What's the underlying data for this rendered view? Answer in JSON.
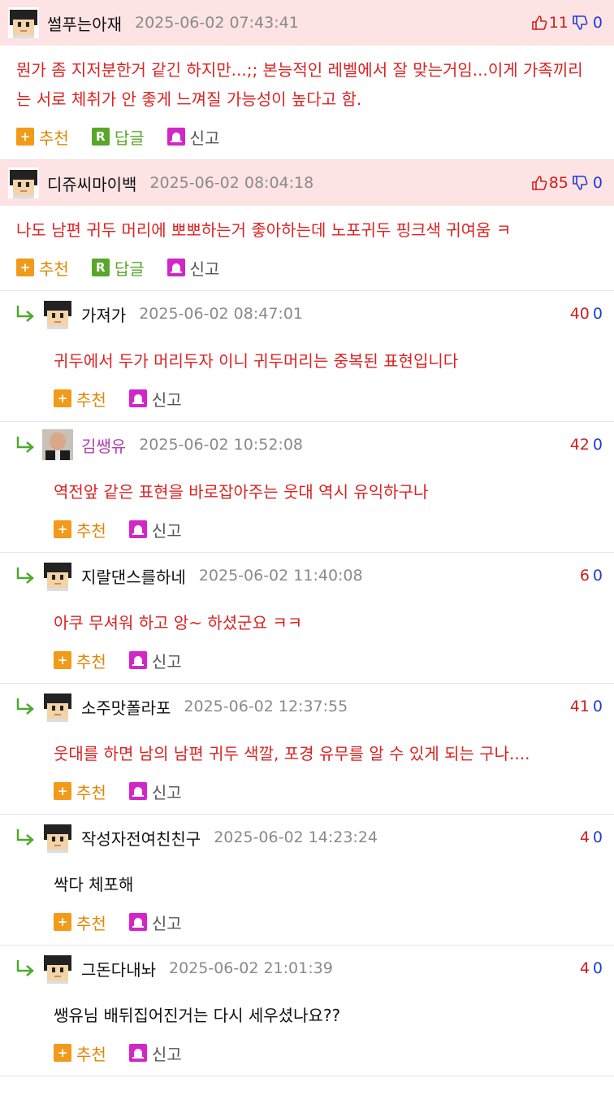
{
  "labels": {
    "recommend": "추천",
    "reply": "답글",
    "report": "신고"
  },
  "colors": {
    "accent_red": "#cc1f1f",
    "accent_blue": "#1f3fcc",
    "highlight_bg": "#fde3e3"
  },
  "comments": [
    {
      "nick": "썰푸는아재",
      "date": "2025-06-02 07:43:41",
      "up": "11",
      "down": "0",
      "text": "뭔가 좀 지저분한거 같긴 하지만...;; 본능적인 레벨에서 잘 맞는거임...이게 가족끼리는 서로 체취가 안 좋게 느껴질 가능성이 높다고 함."
    },
    {
      "nick": "디쥬씨마이백",
      "date": "2025-06-02 08:04:18",
      "up": "85",
      "down": "0",
      "text": "나도 남편 귀두 머리에 뽀뽀하는거 좋아하는데 노포귀두 핑크색 귀여움 ㅋ"
    },
    {
      "nick": "가져가",
      "date": "2025-06-02 08:47:01",
      "up": "40",
      "down": "0",
      "text": "귀두에서 두가 머리두자 이니 귀두머리는 중복된 표현입니다"
    },
    {
      "nick": "김쌩유",
      "date": "2025-06-02 10:52:08",
      "up": "42",
      "down": "0",
      "text": "역전앞 같은 표현을 바로잡아주는 웃대 역시 유익하구나"
    },
    {
      "nick": "지랄댄스를하네",
      "date": "2025-06-02 11:40:08",
      "up": "6",
      "down": "0",
      "text": "아쿠 무셔워 하고 앙~ 하셨군요 ㅋㅋ"
    },
    {
      "nick": "소주맛폴라포",
      "date": "2025-06-02 12:37:55",
      "up": "41",
      "down": "0",
      "text": "웃대를 하면 남의 남편 귀두 색깔, 포경 유무를 알 수 있게 되는 구나...."
    },
    {
      "nick": "작성자전여친친구",
      "date": "2025-06-02 14:23:24",
      "up": "4",
      "down": "0",
      "text": "싹다 체포해"
    },
    {
      "nick": "그돈다내놔",
      "date": "2025-06-02 21:01:39",
      "up": "4",
      "down": "0",
      "text": "쌩유님 배뒤집어진거는 다시 세우셨나요??"
    }
  ]
}
